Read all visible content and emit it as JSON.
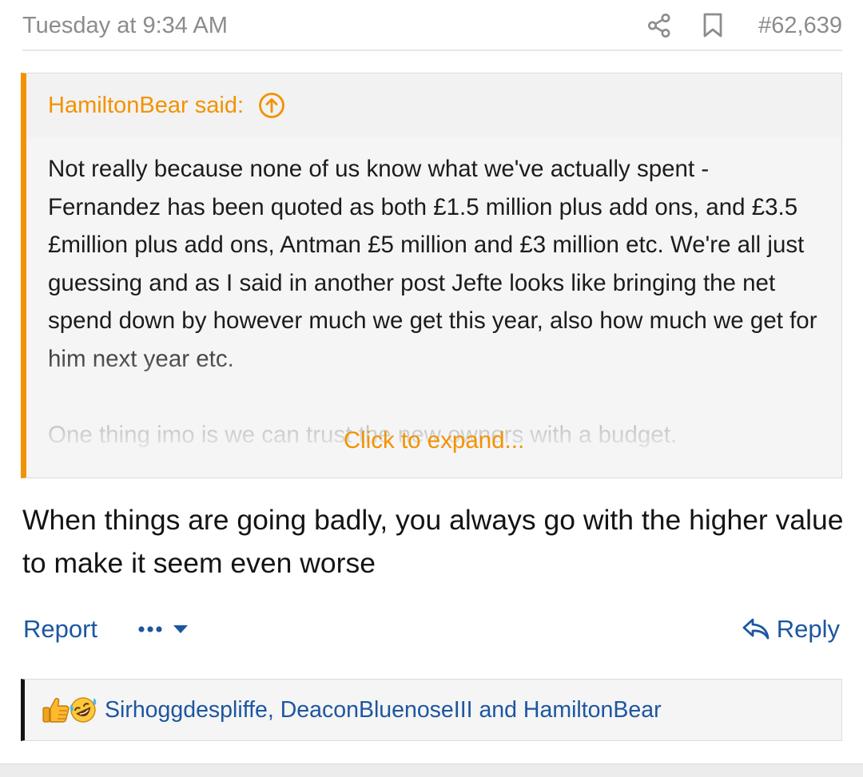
{
  "post": {
    "date": "Tuesday at 9:34 AM",
    "number": "#62,639",
    "actions": {
      "share_icon": "share-icon",
      "bookmark_icon": "bookmark-icon"
    }
  },
  "quote": {
    "author": "HamiltonBear said:",
    "jump_icon": "arrow-up-circle-icon",
    "paragraph1": "Not really because none of us know what we've actually spent - Fernandez has been quoted as both £1.5 million plus add ons, and £3.5 £million plus add ons, Antman £5 million and £3 million etc. We're all just guessing and as I said in another post Jefte looks like bringing the net spend down by however much we get this year, also how much we get for him next year etc.",
    "paragraph2": "One thing imo is we can trust the new owners with a budget.",
    "expand_label": "Click to expand..."
  },
  "message": {
    "text": "When things are going badly, you always go with the higher value to make it seem even worse"
  },
  "footer": {
    "report_label": "Report",
    "more_icon": "ellipsis-icon",
    "dropdown_icon": "caret-down-icon",
    "reply_label": "Reply",
    "reply_icon": "reply-arrow-icon"
  },
  "reactions": {
    "icons": [
      "thumbs-up-icon",
      "laughing-face-icon"
    ],
    "users": "Sirhoggdespliffe, DeaconBluenoseIII and HamiltonBear"
  },
  "colors": {
    "accent": "#f39200",
    "link": "#1d56a0",
    "muted": "#8c8c8c",
    "text": "#141414"
  }
}
